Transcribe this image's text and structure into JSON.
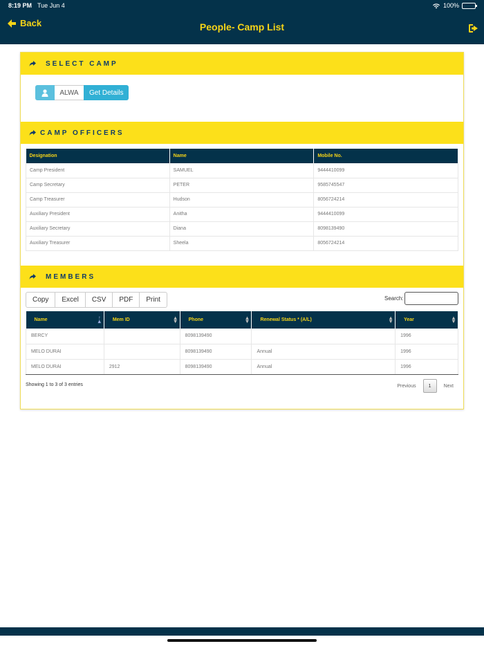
{
  "status_bar": {
    "time": "8:19 PM",
    "date": "Tue Jun 4",
    "battery": "100%"
  },
  "nav": {
    "back_label": "Back",
    "title": "People- Camp List"
  },
  "select_camp": {
    "heading": "SELECT CAMP",
    "camp_value": "ALWA",
    "button_label": "Get Details"
  },
  "camp_officers": {
    "heading": "CAMP OFFICERS",
    "columns": [
      "Designation",
      "Name",
      "Mobile No."
    ],
    "rows": [
      [
        "Camp President",
        "SAMUEL",
        "9444410099"
      ],
      [
        "Camp Secretary",
        "PETER",
        "9585745547"
      ],
      [
        "Camp Treasurer",
        "Hudson",
        "8056724214"
      ],
      [
        "Auxiliary President",
        "Anitha",
        "9444410099"
      ],
      [
        "Auxiliary Secretary",
        "Diana",
        "8098139490"
      ],
      [
        "Auxiliary Treasurer",
        "Sheela",
        "8056724214"
      ]
    ]
  },
  "members": {
    "heading": "MEMBERS",
    "export_buttons": [
      "Copy",
      "Excel",
      "CSV",
      "PDF",
      "Print"
    ],
    "search_label": "Search:",
    "columns": [
      "Name",
      "Mem ID",
      "Phone",
      "Renewal Status * (A/L)",
      "Year"
    ],
    "rows": [
      [
        "BERCY",
        "",
        "8098139490",
        "",
        "1996"
      ],
      [
        "MELO DURAI",
        "",
        "8098139490",
        "Annual",
        "1996"
      ],
      [
        "MELO DURAI",
        "2912",
        "8098139490",
        "Annual",
        "1996"
      ]
    ],
    "info": "Showing 1 to 3 of 3 entries",
    "pagination": {
      "previous": "Previous",
      "page": "1",
      "next": "Next"
    }
  },
  "colors": {
    "navy": "#04324a",
    "yellow": "#fce01a",
    "accent_text": "#f7d417",
    "info_button": "#31b0d5"
  }
}
